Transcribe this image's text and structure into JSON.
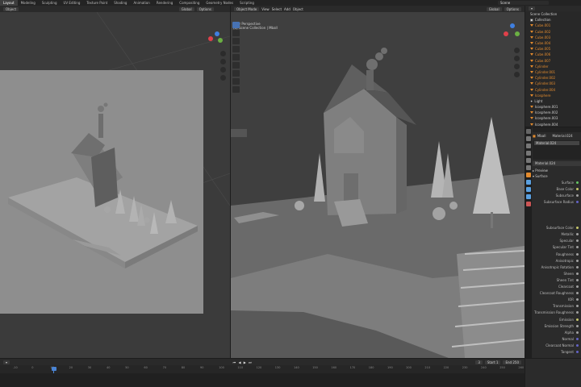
{
  "topbar": {
    "tabs": [
      "Layout",
      "Modeling",
      "Sculpting",
      "UV Editing",
      "Texture Paint",
      "Shading",
      "Animation",
      "Rendering",
      "Compositing",
      "Geometry Nodes",
      "Scripting"
    ],
    "active_tab": "Layout",
    "scene": "Scene"
  },
  "left_viewport": {
    "orientation": "Global",
    "mode": "Object",
    "options": "Options"
  },
  "right_viewport": {
    "mode": "Object Mode",
    "menus": [
      "View",
      "Select",
      "Add",
      "Object"
    ],
    "orientation": "Global",
    "options": "Options",
    "info_line1": "User Perspective",
    "info_line2": "(3) Scene Collection | Mball"
  },
  "outliner": {
    "title": "Scene Collection",
    "collection": "Collection",
    "items": [
      "Cube.001",
      "Cube.002",
      "Cube.003",
      "Cube.004",
      "Cube.005",
      "Cube.006",
      "Cube.007",
      "Cylinder",
      "Cylinder.001",
      "Cylinder.002",
      "Cylinder.003",
      "Cylinder.004",
      "Icosphere",
      "Light",
      "Icosphere.001",
      "Icosphere.002",
      "Icosphere.003",
      "Icosphere.004"
    ]
  },
  "properties": {
    "object": "Mball",
    "material_tab": "Material.024",
    "material_slot": "Material.024",
    "material_name": "Material.024",
    "preview": "Preview",
    "surface": "Surface",
    "surface_label": "Surface",
    "rows": [
      "Base Color",
      "Subsurface",
      "Subsurface Radius",
      "",
      "",
      "",
      "Subsurface Color",
      "Metallic",
      "Specular",
      "Specular Tint",
      "Roughness",
      "Anisotropic",
      "Anisotropic Rotation",
      "Sheen",
      "Sheen Tint",
      "Clearcoat",
      "Clearcoat Roughness",
      "IOR",
      "Transmission",
      "Transmission Roughness",
      "Emission",
      "Emission Strength",
      "Alpha",
      "Normal",
      "Clearcoat Normal",
      "Tangent"
    ]
  },
  "timeline": {
    "ticks": [
      "-10",
      "0",
      "10",
      "20",
      "30",
      "40",
      "50",
      "60",
      "70",
      "80",
      "90",
      "100",
      "110",
      "120",
      "130",
      "140",
      "150",
      "160",
      "170",
      "180",
      "190",
      "200",
      "210",
      "220",
      "230",
      "240",
      "250",
      "260"
    ],
    "current_frame": "3",
    "start_label": "Start",
    "start": "1",
    "end_label": "End",
    "end": "250"
  },
  "colors": {
    "accent": "#4772b3",
    "orange": "#e38b2e",
    "frame_marker": "#4a84d4"
  }
}
